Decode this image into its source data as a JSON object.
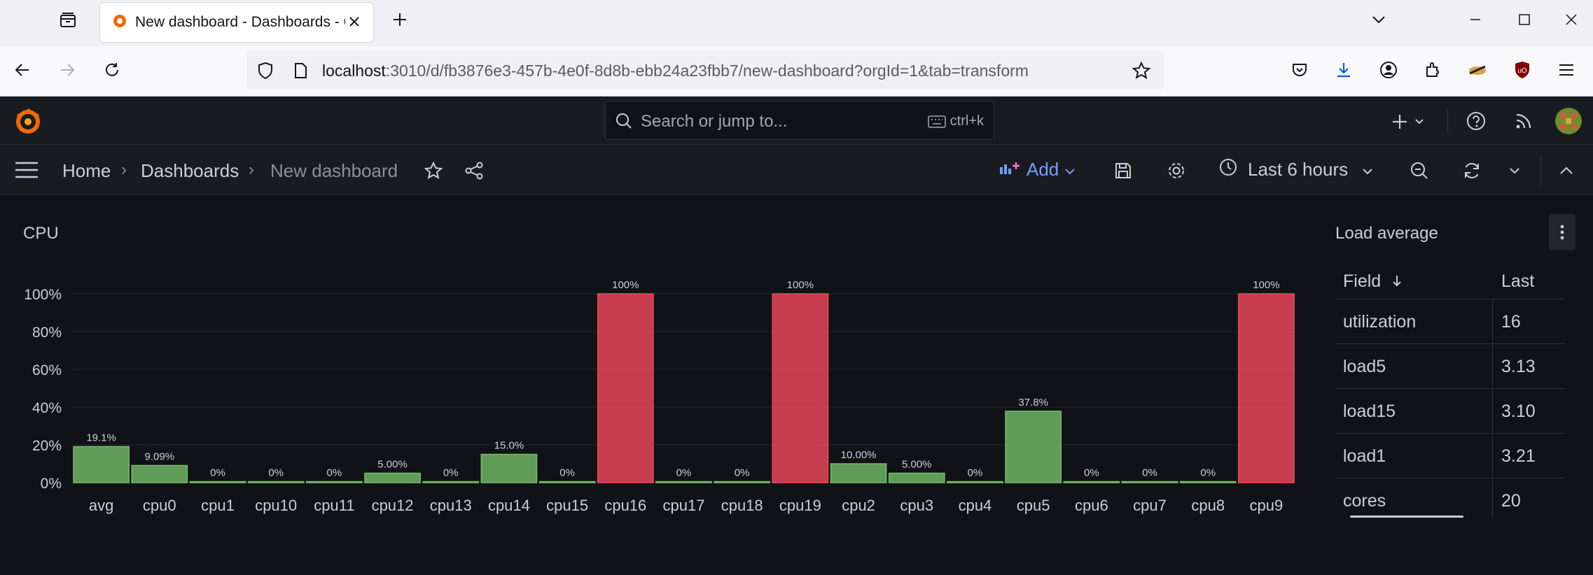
{
  "browser": {
    "tab_title": "New dashboard - Dashboards - Grafana",
    "url_host": "localhost",
    "url_rest": ":3010/d/fb3876e3-457b-4e0f-8d8b-ebb24a23fbb7/new-dashboard?orgId=1&tab=transform"
  },
  "grafana": {
    "search_placeholder": "Search or jump to...",
    "search_shortcut": "ctrl+k",
    "breadcrumb": [
      "Home",
      "Dashboards",
      "New dashboard"
    ],
    "add_label": "Add",
    "time_range": "Last 6 hours"
  },
  "cpu_panel": {
    "title": "CPU"
  },
  "chart_data": {
    "type": "bar",
    "title": "CPU",
    "categories": [
      "avg",
      "cpu0",
      "cpu1",
      "cpu10",
      "cpu11",
      "cpu12",
      "cpu13",
      "cpu14",
      "cpu15",
      "cpu16",
      "cpu17",
      "cpu18",
      "cpu19",
      "cpu2",
      "cpu3",
      "cpu4",
      "cpu5",
      "cpu6",
      "cpu7",
      "cpu8",
      "cpu9"
    ],
    "values": [
      19.1,
      9.09,
      0,
      0,
      0,
      5.0,
      0,
      15.0,
      0,
      100,
      0,
      0,
      100,
      10.0,
      5.0,
      0,
      37.8,
      0,
      0,
      0,
      100
    ],
    "value_labels": [
      "19.1%",
      "9.09%",
      "0%",
      "0%",
      "0%",
      "5.00%",
      "0%",
      "15.0%",
      "0%",
      "100%",
      "0%",
      "0%",
      "100%",
      "10.00%",
      "5.00%",
      "0%",
      "37.8%",
      "0%",
      "0%",
      "0%",
      "100%"
    ],
    "y_ticks": [
      "0%",
      "20%",
      "40%",
      "60%",
      "80%",
      "100%"
    ],
    "ylim": [
      0,
      100
    ],
    "threshold": 80,
    "colors": {
      "ok": "#73bf69",
      "alert": "#f2495c"
    },
    "grid": true
  },
  "load_panel": {
    "title": "Load average",
    "columns": [
      "Field",
      "Last"
    ],
    "rows": [
      {
        "field": "utilization",
        "last": "16"
      },
      {
        "field": "load5",
        "last": "3.13"
      },
      {
        "field": "load15",
        "last": "3.10"
      },
      {
        "field": "load1",
        "last": "3.21"
      },
      {
        "field": "cores",
        "last": "20"
      }
    ]
  }
}
